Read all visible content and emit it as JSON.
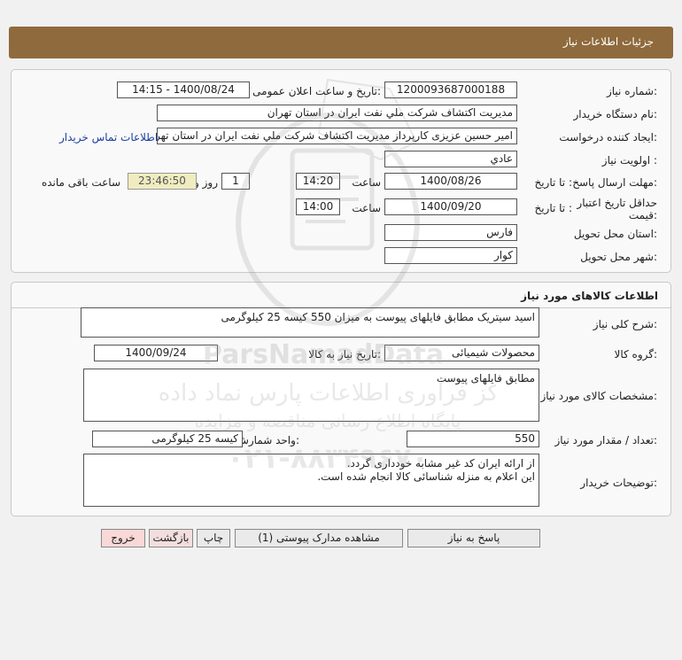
{
  "header": {
    "title": "جزئیات اطلاعات نیاز"
  },
  "need_info": {
    "need_number_label": "شماره نیاز:",
    "need_number": "1200093687000188",
    "announce_datetime_label": "تاریخ و ساعت اعلان عمومی:",
    "announce_datetime": "1400/08/24 - 14:15",
    "buyer_org_label": "نام دستگاه خریدار:",
    "buyer_org": "مديريت اكتشاف شركت ملي نفت ايران در استان تهران",
    "requester_label": "ایجاد کننده درخواست:",
    "requester": "امیر حسین عزیزی کارپرداز مديريت اكتشاف شركت ملي نفت ايران در استان تهران",
    "contact_link": "اطلاعات تماس خریدار",
    "priority_label": "اولویت نیاز :",
    "priority": "عادي",
    "send_deadline_label": "مهلت ارسال پاسخ:",
    "to_date_label": "تا تاریخ :",
    "send_date": "1400/08/26",
    "time_label": "ساعت",
    "send_time": "14:20",
    "days_value": "1",
    "days_label": "روز و",
    "remaining_time": "23:46:50",
    "remaining_label": "ساعت باقی مانده",
    "price_validity_label": "حداقل تاریخ اعتبار قیمت:",
    "validity_to_date_label": "تا تاریخ :",
    "validity_date": "1400/09/20",
    "validity_time_label": "ساعت",
    "validity_time": "14:00",
    "province_label": "استان محل تحویل:",
    "province": "فارس",
    "city_label": "شهر محل تحویل:",
    "city": "کوار"
  },
  "goods": {
    "section_title": "اطلاعات کالاهای مورد نیاز",
    "summary_label": "شرح کلی نیاز:",
    "summary": "اسید سیتریک مطابق فایلهای پیوست به میزان 550 کیسه 25 کیلوگرمی",
    "group_label": "گروه کالا:",
    "group": "محصولات شیمیائی",
    "need_date_label": "تاریخ نیاز به کالا:",
    "need_date": "1400/09/24",
    "specs_label": "مشخصات کالای مورد نیاز:",
    "specs": "مطابق فایلهای پیوست",
    "qty_label": "تعداد / مقدار مورد نیاز:",
    "qty": "550",
    "unit_label": "واحد شمارش:",
    "unit": "کیسه 25 کیلوگرمی",
    "buyer_notes_label": "توضیحات خریدار:",
    "buyer_notes_line1": "از ارائه ایران کد غیر مشابه خودداری گردد.",
    "buyer_notes_line2": "این اعلام به منزله شناسائی کالا انجام شده است."
  },
  "buttons": {
    "reply": "پاسخ به نیاز",
    "attachments": "مشاهده مدارک پیوستی (1)",
    "print": "چاپ",
    "back": "بازگشت",
    "exit": "خروج"
  },
  "watermark": {
    "brand": "ParsNamadData",
    "line1": "مرکز فراوری اطلاعات پارس نماد داده ها",
    "line2": "پایگاه اطلاع رسانی مناقصه و مزایده",
    "phone": "۰۲۱-۸۸۳۴۹۶۷۰"
  }
}
